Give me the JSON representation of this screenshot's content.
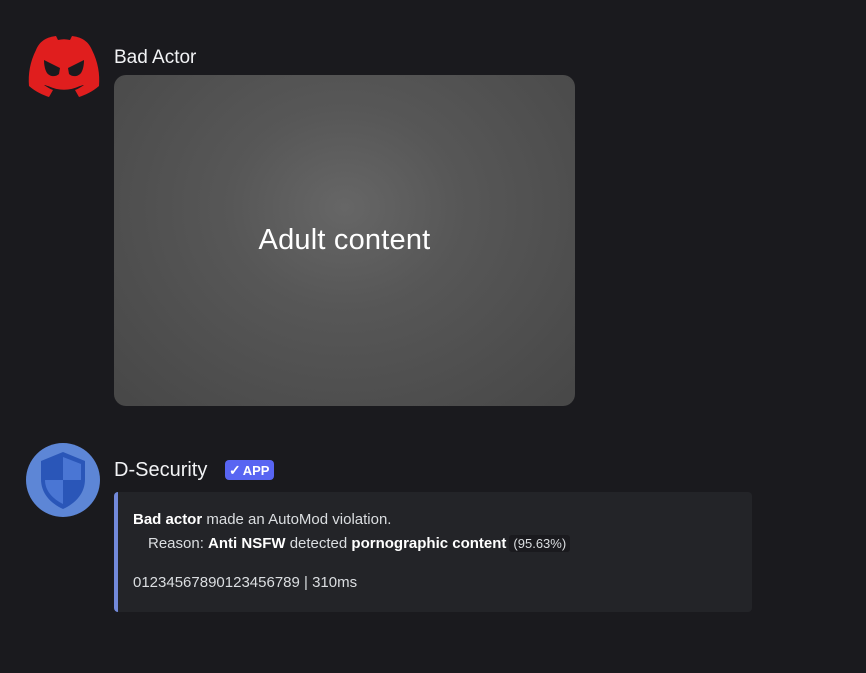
{
  "messages": [
    {
      "author": "Bad Actor",
      "attachment": {
        "label": "Adult content"
      },
      "colors": {
        "avatar": "#e01e1e"
      }
    },
    {
      "author": "D-Security",
      "badge": {
        "check": "✓",
        "label": "APP"
      },
      "embed": {
        "subject": "Bad actor",
        "violation_text": " made an AutoMod violation.",
        "reason_label": "Reason: ",
        "filter_name": "Anti NSFW",
        "detected_text": " detected ",
        "category": "pornographic content",
        "confidence": "(95.63%)",
        "footer": "01234567890123456789 | 310ms"
      },
      "colors": {
        "avatar_bg": "#5d86d6",
        "embed_accent": "#7289da",
        "badge": "#5865f2"
      }
    }
  ]
}
